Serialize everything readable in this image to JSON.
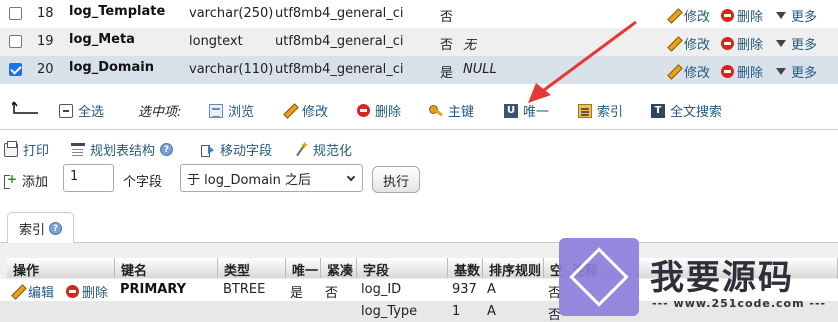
{
  "rows": [
    {
      "num": "18",
      "name": "log_Template",
      "type": "varchar(250)",
      "collation": "utf8mb4_general_ci",
      "null": "否",
      "default": "",
      "checked": false
    },
    {
      "num": "19",
      "name": "log_Meta",
      "type": "longtext",
      "collation": "utf8mb4_general_ci",
      "null": "否",
      "default": "无",
      "checked": false
    },
    {
      "num": "20",
      "name": "log_Domain",
      "type": "varchar(110)",
      "collation": "utf8mb4_general_ci",
      "null": "是",
      "default": "NULL",
      "checked": true
    }
  ],
  "row_actions": {
    "edit": "修改",
    "delete": "删除",
    "more": "更多"
  },
  "bulk": {
    "check_all": "全选",
    "with_selected": "选中项:",
    "browse": "浏览",
    "edit": "修改",
    "delete": "删除",
    "primary": "主键",
    "unique": "唯一",
    "index": "索引",
    "fulltext": "全文搜索"
  },
  "tools": {
    "print": "打印",
    "plan": "规划表结构",
    "move": "移动字段",
    "normalize": "规范化"
  },
  "add": {
    "label": "添加",
    "count": "1",
    "unit": "个字段",
    "position": "于 log_Domain 之后",
    "go": "执行"
  },
  "index_tab": {
    "label": "索引"
  },
  "index_table": {
    "headers": [
      "操作",
      "键名",
      "类型",
      "唯一",
      "紧凑",
      "字段",
      "基数",
      "排序规则",
      "空",
      "注释"
    ],
    "edit": "编辑",
    "delete": "删除",
    "rows": [
      {
        "key": "PRIMARY",
        "type": "BTREE",
        "unique": "是",
        "packed": "否",
        "field": "log_ID",
        "cardinality": "937",
        "collation": "A",
        "null": "否"
      },
      {
        "key": "",
        "type": "",
        "unique": "",
        "packed": "",
        "field": "log_Type",
        "cardinality": "1",
        "collation": "A",
        "null": "否"
      }
    ]
  },
  "watermark": {
    "title": "我要源码",
    "url": "--- www.251code.com ---"
  },
  "colors": {
    "accent": "#235a81",
    "selected_row": "#d8e0ea",
    "arrow": "#e53935",
    "checkbox": "#1a73e8"
  }
}
